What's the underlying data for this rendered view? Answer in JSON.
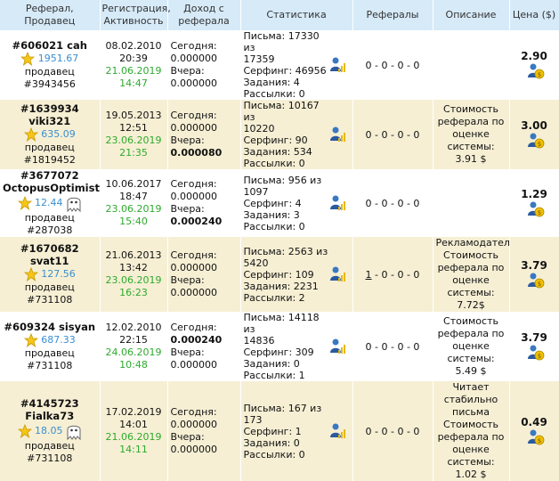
{
  "headers": {
    "col1": "Реферал, Продавец",
    "col2": "Регистрация, Активность",
    "col3": "Доход с реферала",
    "col4": "Статистика",
    "col5": "Рефералы",
    "col6": "Описание",
    "col7": "Цена ($)"
  },
  "labels": {
    "today": "Сегодня:",
    "yesterday": "Вчера:",
    "seller_prefix": "продавец"
  },
  "rows": [
    {
      "id": "#606021 cah",
      "rating": "1951.67",
      "seller": "продавец #3943456",
      "reg_date": "08.02.2010",
      "reg_time": "20:39",
      "act_date": "21.06.2019",
      "act_time": "14:47",
      "today": "0.000000",
      "yesterday": "0.000000",
      "yesterday_bold": false,
      "stat1": "Письма: 17330 из",
      "stat2": "17359",
      "stat3": "Серфинг: 46956",
      "stat4": "Задания: 4",
      "stat5": "Рассылки: 0",
      "refs_link": "",
      "refs": "0 - 0 - 0 - 0",
      "desc": [],
      "price": "2.90"
    },
    {
      "id": "#1639934 viki321",
      "rating": "635.09",
      "seller": "продавец #1819452",
      "reg_date": "19.05.2013",
      "reg_time": "12:51",
      "act_date": "23.06.2019",
      "act_time": "21:35",
      "today": "0.000000",
      "yesterday": "0.000080",
      "yesterday_bold": true,
      "stat1": "Письма: 10167 из",
      "stat2": "10220",
      "stat3": "Серфинг: 90",
      "stat4": "Задания: 534",
      "stat5": "Рассылки: 0",
      "refs_link": "",
      "refs": "0 - 0 - 0 - 0",
      "desc": [
        "Стоимость",
        "реферала по",
        "оценке",
        "системы: 3.91 $"
      ],
      "price": "3.00"
    },
    {
      "id": "#3677072",
      "id2": "OctopusOptimist",
      "rating": "12.44",
      "seller": "продавец",
      "seller2": "#287038",
      "reg_date": "10.06.2017",
      "reg_time": "18:47",
      "act_date": "23.06.2019",
      "act_time": "15:40",
      "today": "0.000000",
      "yesterday": "0.000240",
      "yesterday_bold": true,
      "stat1": "Письма: 956 из 1097",
      "stat2": "",
      "stat3": "Серфинг: 4",
      "stat4": "Задания: 3",
      "stat5": "Рассылки: 0",
      "refs_link": "",
      "refs": "0 - 0 - 0 - 0",
      "desc": [],
      "price": "1.29"
    },
    {
      "id": "#1670682 svat11",
      "rating": "127.56",
      "seller": "продавец #731108",
      "reg_date": "21.06.2013",
      "reg_time": "13:42",
      "act_date": "23.06.2019",
      "act_time": "16:23",
      "today": "0.000000",
      "yesterday": "0.000000",
      "yesterday_bold": false,
      "stat1": "Письма: 2563 из 5420",
      "stat2": "",
      "stat3": "Серфинг: 109",
      "stat4": "Задания: 2231",
      "stat5": "Рассылки: 2",
      "refs_link": "1",
      "refs": " - 0 - 0 - 0",
      "desc": [
        "Рекламодатель",
        "Стоимость",
        "реферала по",
        "оценке",
        "системы: 7.72$"
      ],
      "price": "3.79"
    },
    {
      "id": "#609324 sisyan",
      "rating": "687.33",
      "seller": "продавец #731108",
      "reg_date": "12.02.2010",
      "reg_time": "22:15",
      "act_date": "24.06.2019",
      "act_time": "10:48",
      "today": "0.000240",
      "today_bold": true,
      "yesterday": "0.000000",
      "yesterday_bold": false,
      "stat1": "Письма: 14118 из",
      "stat2": "14836",
      "stat3": "Серфинг: 309",
      "stat4": "Задания: 0",
      "stat5": "Рассылки: 1",
      "refs_link": "",
      "refs": "0 - 0 - 0 - 0",
      "desc": [
        "Стоимость",
        "реферала по",
        "оценке",
        "системы: 5.49 $"
      ],
      "price": "3.79"
    },
    {
      "id": "#4145723",
      "id2": "Fialka73",
      "rating": "18.05",
      "seller": "продавец #731108",
      "reg_date": "17.02.2019",
      "reg_time": "14:01",
      "act_date": "21.06.2019",
      "act_time": "14:11",
      "today": "0.000000",
      "yesterday": "0.000000",
      "yesterday_bold": false,
      "stat1": "Письма: 167 из 173",
      "stat2": "",
      "stat3": "Серфинг: 1",
      "stat4": "Задания: 0",
      "stat5": "Рассылки: 0",
      "refs_link": "",
      "refs": "0 - 0 - 0 - 0",
      "desc": [
        "Читает",
        "стабильно",
        "письма",
        "Стоимость",
        "реферала по",
        "оценке",
        "системы: 1.02 $"
      ],
      "price": "0.49"
    }
  ]
}
